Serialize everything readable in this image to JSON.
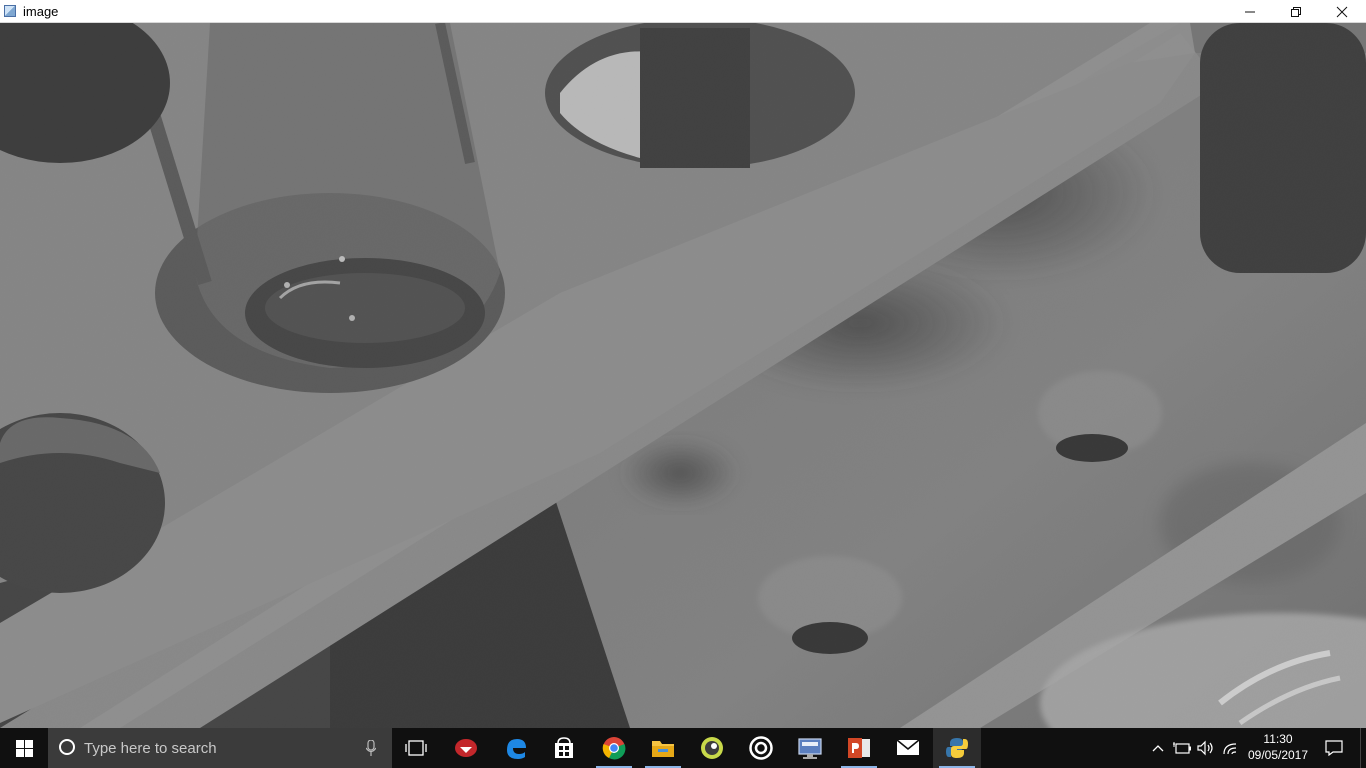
{
  "window": {
    "title": "image",
    "icons": {
      "app": "image-window-icon",
      "minimize": "minimize-icon",
      "maximize": "restore-icon",
      "close": "close-icon"
    }
  },
  "viewport": {
    "content": "grayscale camera image of a test tube rack"
  },
  "taskbar": {
    "start_icon": "windows-logo-icon",
    "search_placeholder": "Type here to search",
    "pinned": [
      {
        "name": "cortana-mic-icon"
      },
      {
        "name": "task-view-icon"
      },
      {
        "name": "red-app-icon"
      },
      {
        "name": "edge-icon"
      },
      {
        "name": "store-icon"
      },
      {
        "name": "chrome-icon"
      },
      {
        "name": "file-explorer-icon"
      },
      {
        "name": "green-app-icon"
      },
      {
        "name": "media-player-icon"
      },
      {
        "name": "monitor-app-icon"
      },
      {
        "name": "powerpoint-icon"
      },
      {
        "name": "mail-icon"
      },
      {
        "name": "python-icon"
      }
    ],
    "tray": {
      "icons": [
        "show-hidden-icons-chevron-icon",
        "battery-icon",
        "volume-icon",
        "wifi-icon"
      ],
      "time": "11:30",
      "date": "09/05/2017",
      "notification_icon": "action-center-icon"
    }
  }
}
